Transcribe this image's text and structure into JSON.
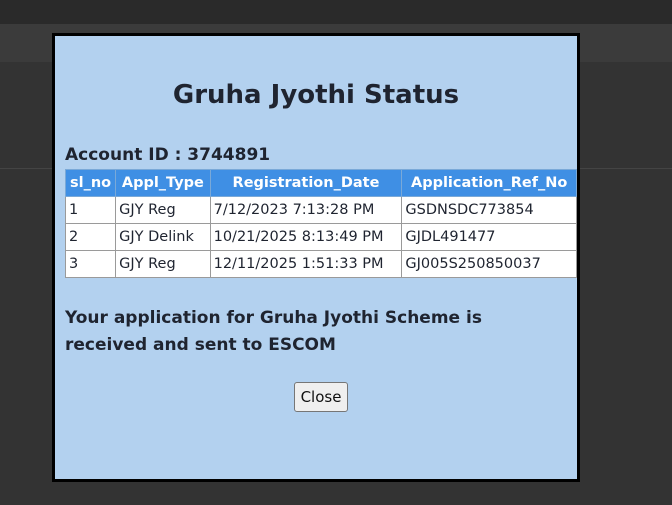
{
  "modal": {
    "title": "Gruha Jyothi Status",
    "account_label": "Account ID : 3744891",
    "table": {
      "columns": [
        "sl_no",
        "Appl_Type",
        "Registration_Date",
        "Application_Ref_No"
      ],
      "rows": [
        [
          "1",
          "GJY Reg",
          "7/12/2023 7:13:28 PM",
          "GSDNSDC773854"
        ],
        [
          "2",
          "GJY Delink",
          "10/21/2025 8:13:49 PM",
          "GJDL491477"
        ],
        [
          "3",
          "GJY Reg",
          "12/11/2025 1:51:33 PM",
          "GJ005S250850037"
        ]
      ]
    },
    "message": "Your application for Gruha Jyothi Scheme is received and sent to ESCOM",
    "close_label": "Close"
  },
  "colors": {
    "overlay": "#333333",
    "modal_bg": "#b3d1ef",
    "table_header": "#3f8fe4"
  }
}
